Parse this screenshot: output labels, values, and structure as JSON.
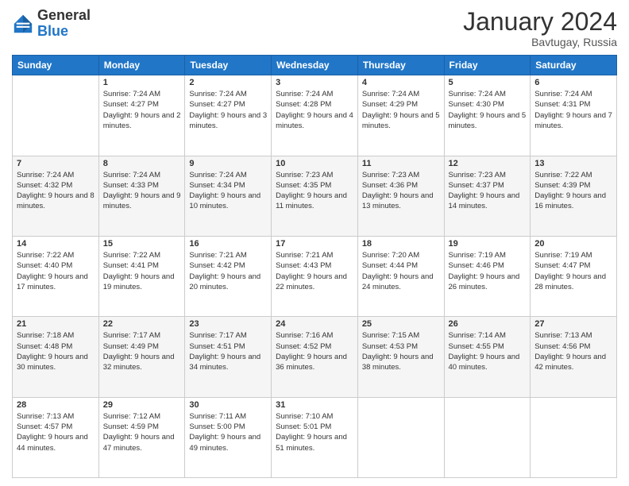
{
  "header": {
    "logo": {
      "general": "General",
      "blue": "Blue"
    },
    "title": "January 2024",
    "subtitle": "Bavtugay, Russia"
  },
  "weekdays": [
    "Sunday",
    "Monday",
    "Tuesday",
    "Wednesday",
    "Thursday",
    "Friday",
    "Saturday"
  ],
  "weeks": [
    [
      {
        "day": "",
        "sunrise": "",
        "sunset": "",
        "daylight": ""
      },
      {
        "day": "1",
        "sunrise": "Sunrise: 7:24 AM",
        "sunset": "Sunset: 4:27 PM",
        "daylight": "Daylight: 9 hours and 2 minutes."
      },
      {
        "day": "2",
        "sunrise": "Sunrise: 7:24 AM",
        "sunset": "Sunset: 4:27 PM",
        "daylight": "Daylight: 9 hours and 3 minutes."
      },
      {
        "day": "3",
        "sunrise": "Sunrise: 7:24 AM",
        "sunset": "Sunset: 4:28 PM",
        "daylight": "Daylight: 9 hours and 4 minutes."
      },
      {
        "day": "4",
        "sunrise": "Sunrise: 7:24 AM",
        "sunset": "Sunset: 4:29 PM",
        "daylight": "Daylight: 9 hours and 5 minutes."
      },
      {
        "day": "5",
        "sunrise": "Sunrise: 7:24 AM",
        "sunset": "Sunset: 4:30 PM",
        "daylight": "Daylight: 9 hours and 5 minutes."
      },
      {
        "day": "6",
        "sunrise": "Sunrise: 7:24 AM",
        "sunset": "Sunset: 4:31 PM",
        "daylight": "Daylight: 9 hours and 7 minutes."
      }
    ],
    [
      {
        "day": "7",
        "sunrise": "Sunrise: 7:24 AM",
        "sunset": "Sunset: 4:32 PM",
        "daylight": "Daylight: 9 hours and 8 minutes."
      },
      {
        "day": "8",
        "sunrise": "Sunrise: 7:24 AM",
        "sunset": "Sunset: 4:33 PM",
        "daylight": "Daylight: 9 hours and 9 minutes."
      },
      {
        "day": "9",
        "sunrise": "Sunrise: 7:24 AM",
        "sunset": "Sunset: 4:34 PM",
        "daylight": "Daylight: 9 hours and 10 minutes."
      },
      {
        "day": "10",
        "sunrise": "Sunrise: 7:23 AM",
        "sunset": "Sunset: 4:35 PM",
        "daylight": "Daylight: 9 hours and 11 minutes."
      },
      {
        "day": "11",
        "sunrise": "Sunrise: 7:23 AM",
        "sunset": "Sunset: 4:36 PM",
        "daylight": "Daylight: 9 hours and 13 minutes."
      },
      {
        "day": "12",
        "sunrise": "Sunrise: 7:23 AM",
        "sunset": "Sunset: 4:37 PM",
        "daylight": "Daylight: 9 hours and 14 minutes."
      },
      {
        "day": "13",
        "sunrise": "Sunrise: 7:22 AM",
        "sunset": "Sunset: 4:39 PM",
        "daylight": "Daylight: 9 hours and 16 minutes."
      }
    ],
    [
      {
        "day": "14",
        "sunrise": "Sunrise: 7:22 AM",
        "sunset": "Sunset: 4:40 PM",
        "daylight": "Daylight: 9 hours and 17 minutes."
      },
      {
        "day": "15",
        "sunrise": "Sunrise: 7:22 AM",
        "sunset": "Sunset: 4:41 PM",
        "daylight": "Daylight: 9 hours and 19 minutes."
      },
      {
        "day": "16",
        "sunrise": "Sunrise: 7:21 AM",
        "sunset": "Sunset: 4:42 PM",
        "daylight": "Daylight: 9 hours and 20 minutes."
      },
      {
        "day": "17",
        "sunrise": "Sunrise: 7:21 AM",
        "sunset": "Sunset: 4:43 PM",
        "daylight": "Daylight: 9 hours and 22 minutes."
      },
      {
        "day": "18",
        "sunrise": "Sunrise: 7:20 AM",
        "sunset": "Sunset: 4:44 PM",
        "daylight": "Daylight: 9 hours and 24 minutes."
      },
      {
        "day": "19",
        "sunrise": "Sunrise: 7:19 AM",
        "sunset": "Sunset: 4:46 PM",
        "daylight": "Daylight: 9 hours and 26 minutes."
      },
      {
        "day": "20",
        "sunrise": "Sunrise: 7:19 AM",
        "sunset": "Sunset: 4:47 PM",
        "daylight": "Daylight: 9 hours and 28 minutes."
      }
    ],
    [
      {
        "day": "21",
        "sunrise": "Sunrise: 7:18 AM",
        "sunset": "Sunset: 4:48 PM",
        "daylight": "Daylight: 9 hours and 30 minutes."
      },
      {
        "day": "22",
        "sunrise": "Sunrise: 7:17 AM",
        "sunset": "Sunset: 4:49 PM",
        "daylight": "Daylight: 9 hours and 32 minutes."
      },
      {
        "day": "23",
        "sunrise": "Sunrise: 7:17 AM",
        "sunset": "Sunset: 4:51 PM",
        "daylight": "Daylight: 9 hours and 34 minutes."
      },
      {
        "day": "24",
        "sunrise": "Sunrise: 7:16 AM",
        "sunset": "Sunset: 4:52 PM",
        "daylight": "Daylight: 9 hours and 36 minutes."
      },
      {
        "day": "25",
        "sunrise": "Sunrise: 7:15 AM",
        "sunset": "Sunset: 4:53 PM",
        "daylight": "Daylight: 9 hours and 38 minutes."
      },
      {
        "day": "26",
        "sunrise": "Sunrise: 7:14 AM",
        "sunset": "Sunset: 4:55 PM",
        "daylight": "Daylight: 9 hours and 40 minutes."
      },
      {
        "day": "27",
        "sunrise": "Sunrise: 7:13 AM",
        "sunset": "Sunset: 4:56 PM",
        "daylight": "Daylight: 9 hours and 42 minutes."
      }
    ],
    [
      {
        "day": "28",
        "sunrise": "Sunrise: 7:13 AM",
        "sunset": "Sunset: 4:57 PM",
        "daylight": "Daylight: 9 hours and 44 minutes."
      },
      {
        "day": "29",
        "sunrise": "Sunrise: 7:12 AM",
        "sunset": "Sunset: 4:59 PM",
        "daylight": "Daylight: 9 hours and 47 minutes."
      },
      {
        "day": "30",
        "sunrise": "Sunrise: 7:11 AM",
        "sunset": "Sunset: 5:00 PM",
        "daylight": "Daylight: 9 hours and 49 minutes."
      },
      {
        "day": "31",
        "sunrise": "Sunrise: 7:10 AM",
        "sunset": "Sunset: 5:01 PM",
        "daylight": "Daylight: 9 hours and 51 minutes."
      },
      {
        "day": "",
        "sunrise": "",
        "sunset": "",
        "daylight": ""
      },
      {
        "day": "",
        "sunrise": "",
        "sunset": "",
        "daylight": ""
      },
      {
        "day": "",
        "sunrise": "",
        "sunset": "",
        "daylight": ""
      }
    ]
  ]
}
